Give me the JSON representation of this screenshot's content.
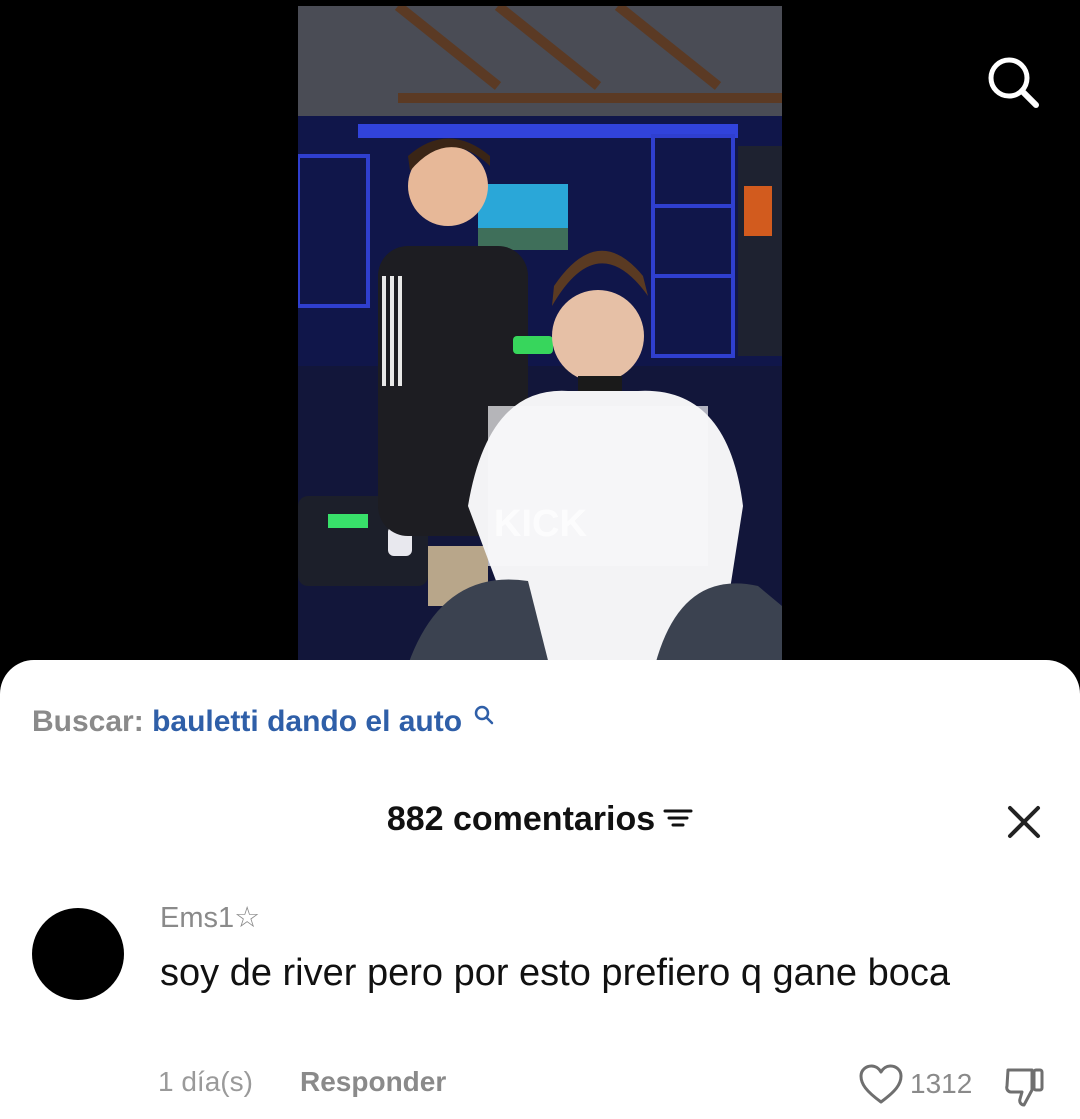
{
  "video": {
    "watermark": "KICK",
    "search_icon": "search-icon",
    "colors": {
      "backdrop": "#000000",
      "room_blue": "#1f2fb8",
      "shelf_glow": "#3a4fff",
      "sofa": "#2a2f3c"
    }
  },
  "search_suggestion": {
    "prefix": "Buscar:",
    "query": "bauletti dando el auto",
    "icon": "search-icon",
    "query_color": "#2f5fa8"
  },
  "comments_header": {
    "title": "882 comentarios",
    "sort_icon": "sort-icon",
    "close_icon": "close-icon"
  },
  "comments": [
    {
      "username": "Ems1☆",
      "text": "soy de river pero por esto prefiero q gane boca",
      "time": "1 día(s)",
      "reply_label": "Responder",
      "likes": "1312",
      "like_icon": "heart-icon",
      "dislike_icon": "thumbs-down-icon"
    }
  ]
}
